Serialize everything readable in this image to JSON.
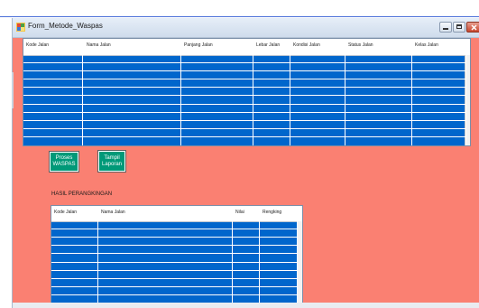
{
  "document": {
    "visible_text_before": "",
    "visible_text_underlined": ""
  },
  "window": {
    "title": "Form_Metode_Waspas",
    "bg_color": "#fa8072"
  },
  "grid1": {
    "columns": [
      "Kode Jalan",
      "Nama Jalan",
      "Panjang Jalan",
      "Lebar Jalan",
      "Kondisi Jalan",
      "Status Jalan",
      "Kelas Jalan"
    ],
    "row_count": 11,
    "row_color": "#0066cc"
  },
  "buttons": {
    "proses": "Proses\nWASPAS",
    "tampil": "Tampil\nLaporan"
  },
  "hasil_label": "HASIL PERANGKINGAN",
  "grid2": {
    "columns": [
      "Kode Jalan",
      "Nama Jalan",
      "Nilai",
      "Rengking"
    ],
    "row_count": 10
  }
}
